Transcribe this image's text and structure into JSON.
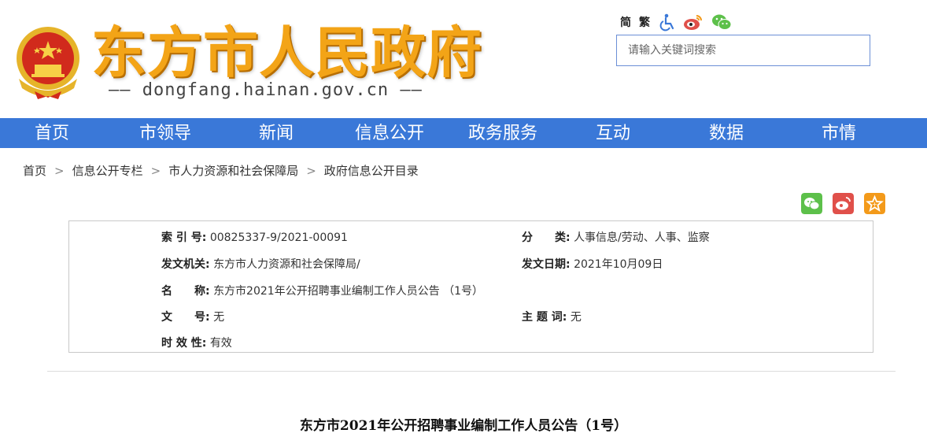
{
  "header": {
    "site_title": "东方市人民政府",
    "site_domain": "—— dongfang.hainan.gov.cn ——",
    "lang_simplified": "简",
    "lang_traditional": "繁",
    "search_placeholder": "请输入关键词搜索",
    "icons": [
      "accessibility-icon",
      "weibo-icon",
      "wechat-icon"
    ]
  },
  "nav": {
    "items": [
      "首页",
      "市领导",
      "新闻",
      "信息公开",
      "政务服务",
      "互动",
      "数据",
      "市情"
    ]
  },
  "breadcrumb": [
    "首页",
    "信息公开专栏",
    "市人力资源和社会保障局",
    "政府信息公开目录"
  ],
  "share": [
    "wechat-share-icon",
    "weibo-share-icon",
    "favorite-share-icon"
  ],
  "info": {
    "index_label": "索 引 号:",
    "index_value": "00825337-9/2021-00091",
    "category_label": "分　　类:",
    "category_value": "人事信息/劳动、人事、监察",
    "issuer_label": "发文机关:",
    "issuer_value": "东方市人力资源和社会保障局/",
    "date_label": "发文日期:",
    "date_value": "2021年10月09日",
    "name_label": "名　　称:",
    "name_value": "东方市2021年公开招聘事业编制工作人员公告 （1号）",
    "docno_label": "文　　号:",
    "docno_value": "无",
    "subject_label": "主 题 词:",
    "subject_value": "无",
    "validity_label": "时 效 性:",
    "validity_value": "有效"
  },
  "article": {
    "title": "东方市2021年公开招聘事业编制工作人员公告（1号）"
  },
  "colors": {
    "nav_bg": "#3a78d8",
    "title_orange": "#f3a417",
    "wechat_green": "#5dc04a",
    "weibo_red": "#e0504a",
    "favorite_orange": "#f39a1a"
  }
}
